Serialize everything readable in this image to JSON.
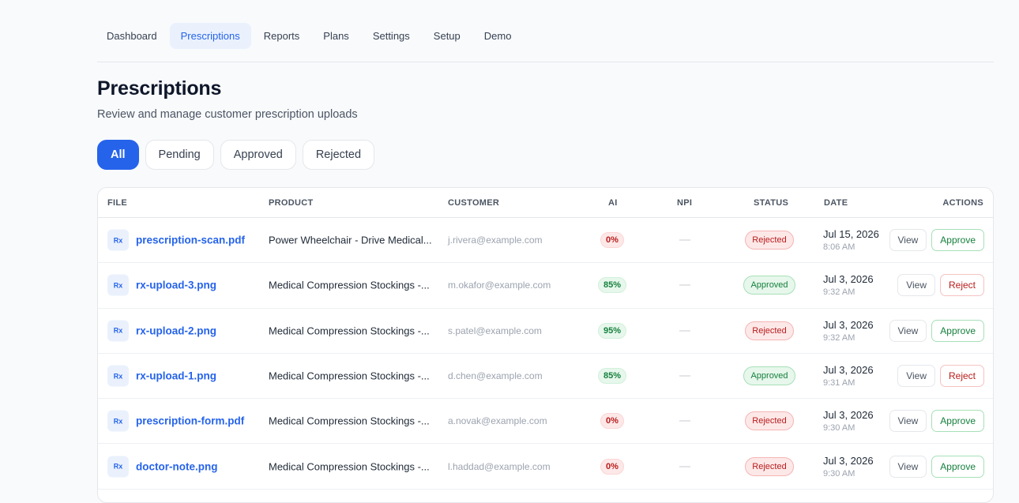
{
  "nav": {
    "items": [
      "Dashboard",
      "Prescriptions",
      "Reports",
      "Plans",
      "Settings",
      "Setup",
      "Demo"
    ],
    "active": "Prescriptions"
  },
  "page": {
    "title": "Prescriptions",
    "subtitle": "Review and manage customer prescription uploads"
  },
  "filters": {
    "items": [
      "All",
      "Pending",
      "Approved",
      "Rejected"
    ],
    "active": "All"
  },
  "table": {
    "columns": [
      "FILE",
      "PRODUCT",
      "CUSTOMER",
      "AI",
      "NPI",
      "STATUS",
      "DATE",
      "ACTIONS"
    ],
    "file_icon": "Rx",
    "npi_placeholder": "—",
    "rows": [
      {
        "file": "prescription-scan.pdf",
        "product": "Power Wheelchair - Drive Medical...",
        "customer": "j.rivera@example.com",
        "ai": "0%",
        "npi": "—",
        "status": "Rejected",
        "date": "Jul 15, 2026",
        "time": "8:06 AM",
        "actions": [
          "View",
          "Approve"
        ]
      },
      {
        "file": "rx-upload-3.png",
        "product": "Medical Compression Stockings -...",
        "customer": "m.okafor@example.com",
        "ai": "85%",
        "npi": "—",
        "status": "Approved",
        "date": "Jul 3, 2026",
        "time": "9:32 AM",
        "actions": [
          "View",
          "Reject"
        ]
      },
      {
        "file": "rx-upload-2.png",
        "product": "Medical Compression Stockings -...",
        "customer": "s.patel@example.com",
        "ai": "95%",
        "npi": "—",
        "status": "Rejected",
        "date": "Jul 3, 2026",
        "time": "9:32 AM",
        "actions": [
          "View",
          "Approve"
        ]
      },
      {
        "file": "rx-upload-1.png",
        "product": "Medical Compression Stockings -...",
        "customer": "d.chen@example.com",
        "ai": "85%",
        "npi": "—",
        "status": "Approved",
        "date": "Jul 3, 2026",
        "time": "9:31 AM",
        "actions": [
          "View",
          "Reject"
        ]
      },
      {
        "file": "prescription-form.pdf",
        "product": "Medical Compression Stockings -...",
        "customer": "a.novak@example.com",
        "ai": "0%",
        "npi": "—",
        "status": "Rejected",
        "date": "Jul 3, 2026",
        "time": "9:30 AM",
        "actions": [
          "View",
          "Approve"
        ]
      },
      {
        "file": "doctor-note.png",
        "product": "Medical Compression Stockings -...",
        "customer": "l.haddad@example.com",
        "ai": "0%",
        "npi": "—",
        "status": "Rejected",
        "date": "Jul 3, 2026",
        "time": "9:30 AM",
        "actions": [
          "View",
          "Approve"
        ]
      }
    ]
  },
  "colors": {
    "accent": "#2563eb",
    "success": "#15803d",
    "danger": "#b91c1c",
    "background": "#f8fafc"
  }
}
